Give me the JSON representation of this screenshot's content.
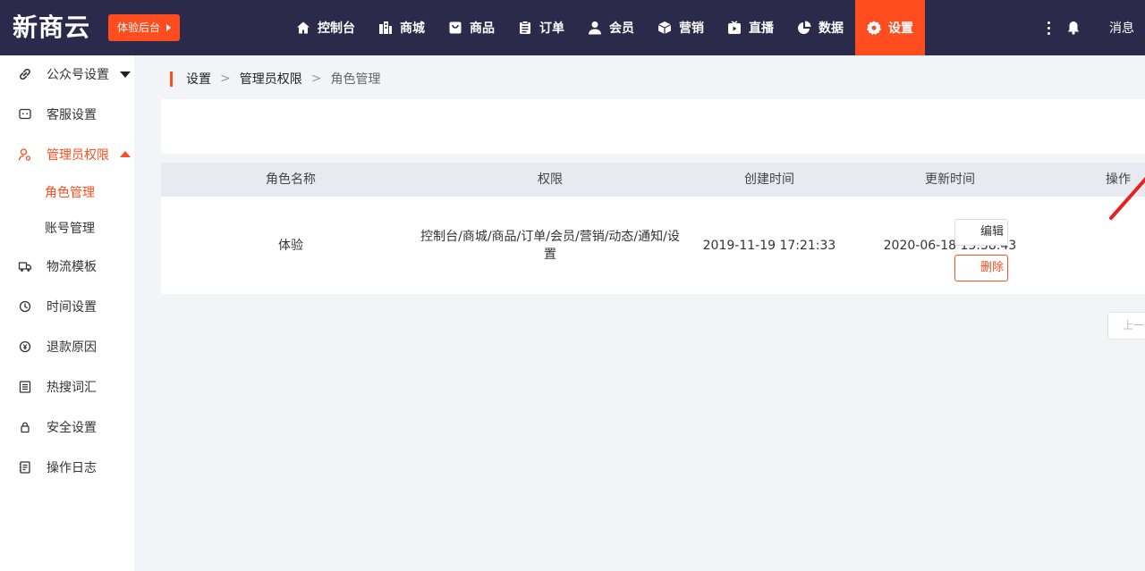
{
  "header": {
    "logo": "新商云",
    "trial_label": "体验后台",
    "nav": [
      {
        "label": "控制台",
        "icon": "home-icon"
      },
      {
        "label": "商城",
        "icon": "building-icon"
      },
      {
        "label": "商品",
        "icon": "bag-icon"
      },
      {
        "label": "订单",
        "icon": "clipboard-icon"
      },
      {
        "label": "会员",
        "icon": "user-icon"
      },
      {
        "label": "营销",
        "icon": "cube-icon"
      },
      {
        "label": "直播",
        "icon": "play-icon"
      },
      {
        "label": "数据",
        "icon": "pie-chart-icon"
      },
      {
        "label": "设置",
        "icon": "gear-icon",
        "active": true
      }
    ],
    "messages_label": "消息"
  },
  "sidebar": {
    "items": [
      {
        "label": "公众号设置",
        "icon": "link-icon"
      },
      {
        "label": "客服设置",
        "icon": "chat-icon"
      },
      {
        "label": "管理员权限",
        "icon": "admin-user-icon",
        "expanded": true
      },
      {
        "label": "物流模板",
        "icon": "truck-icon"
      },
      {
        "label": "时间设置",
        "icon": "clock-icon"
      },
      {
        "label": "退款原因",
        "icon": "refund-icon"
      },
      {
        "label": "热搜词汇",
        "icon": "list-icon"
      },
      {
        "label": "安全设置",
        "icon": "lock-icon"
      },
      {
        "label": "操作日志",
        "icon": "log-icon"
      }
    ],
    "sub_items": [
      {
        "label": "角色管理",
        "active": true
      },
      {
        "label": "账号管理"
      }
    ]
  },
  "breadcrumb": [
    "设置",
    "管理员权限",
    "角色管理"
  ],
  "breadcrumb_sep": ">",
  "table": {
    "columns": [
      "角色名称",
      "权限",
      "创建时间",
      "更新时间",
      "操作"
    ],
    "rows": [
      {
        "name": "体验",
        "permissions": "控制台/商城/商品/订单/会员/营销/动态/通知/设置",
        "created": "2019-11-19 17:21:33",
        "updated": "2020-06-18 13:58:43",
        "edit_label": "编辑",
        "delete_label": "删除"
      }
    ]
  },
  "pagination": {
    "prev_label": "上一页"
  },
  "colors": {
    "accent": "#ff4d1f",
    "topbar": "#2b2a4a",
    "table_header": "#e8eaf2",
    "background": "#f3f4f8"
  }
}
